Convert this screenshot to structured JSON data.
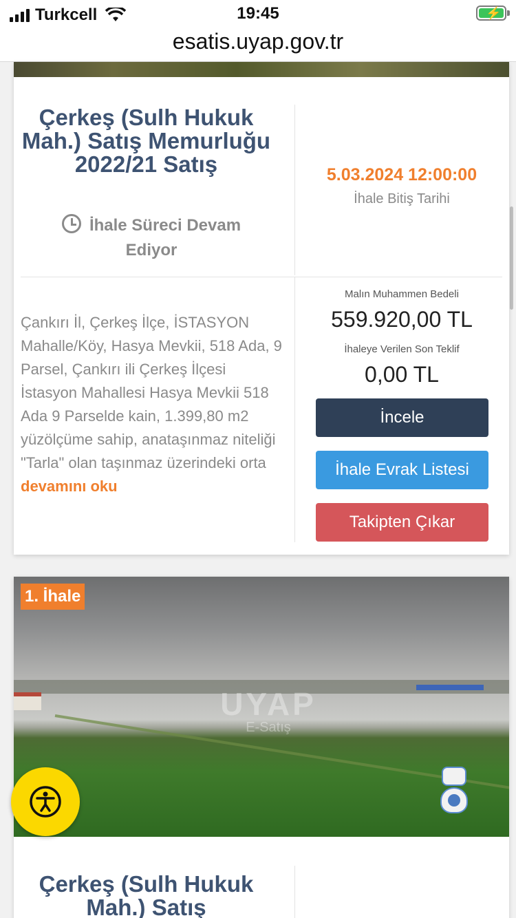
{
  "status_bar": {
    "carrier": "Turkcell",
    "time": "19:45",
    "battery_color": "#3cc45a"
  },
  "browser": {
    "url": "esatis.uyap.gov.tr"
  },
  "listing1": {
    "title": "Çerkeş (Sulh Hukuk Mah.) Satış Memurluğu 2022/21 Satış",
    "status": "İhale Süreci Devam Ediyor",
    "end_date": "5.03.2024 12:00:00",
    "end_date_label": "İhale Bitiş Tarihi",
    "description": "Çankırı İl, Çerkeş İlçe, İSTASYON Mahalle/Köy, Hasya Mevkii, 518 Ada, 9 Parsel, Çankırı ili Çerkeş İlçesi İstasyon Mahallesi Hasya Mevkii 518 Ada 9 Parselde kain, 1.399,80 m2 yüzölçüme sahip, anataşınmaz niteliği \"Tarla\" olan taşınmaz üzerindeki orta",
    "read_more": "devamını oku",
    "estimated_value_label": "Malın Muhammen Bedeli",
    "estimated_value": "559.920,00 TL",
    "last_bid_label": "İhaleye Verilen Son Teklif",
    "last_bid": "0,00 TL",
    "buttons": {
      "inspect": "İncele",
      "documents": "İhale Evrak Listesi",
      "unfollow": "Takipten Çıkar"
    },
    "colors": {
      "title": "#3e5372",
      "accent": "#f07f2d",
      "dark_btn": "#2f4057",
      "blue_btn": "#3a9ae0",
      "red_btn": "#d5565a"
    }
  },
  "listing2": {
    "badge": "1. İhale",
    "watermark": "UYAP",
    "watermark_sub": "E-Satış",
    "title": "Çerkeş (Sulh Hukuk Mah.) Satış"
  },
  "icons": {
    "clock": "clock-icon",
    "accessibility": "accessibility-icon",
    "assistant": "robot-assistant-icon"
  }
}
